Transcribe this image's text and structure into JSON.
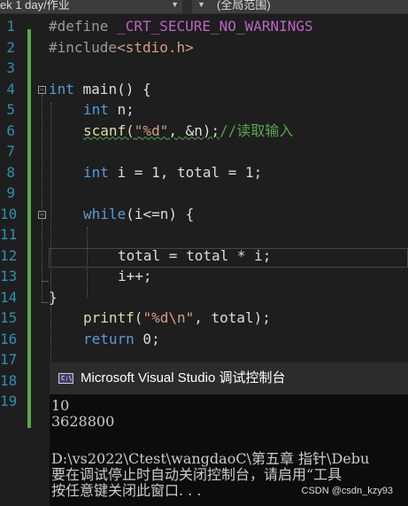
{
  "tabs": {
    "project": "ek 1 day/作业",
    "scope": "(全局范围)"
  },
  "line_numbers": [
    "1",
    "2",
    "3",
    "4",
    "5",
    "6",
    "7",
    "8",
    "9",
    "10",
    "11",
    "12",
    "13",
    "14",
    "15",
    "16",
    "17",
    "18",
    "19"
  ],
  "code": {
    "l1_directive": "#define",
    "l1_macro": "_CRT_SECURE_NO_WARNINGS",
    "l2_directive": "#include",
    "l2_header": "<stdio.h>",
    "l4_type": "int",
    "l4_rest": " main() {",
    "l5_type": "int",
    "l5_rest": " n;",
    "l6_call": "scanf(",
    "l6_format": "\"%d\"",
    "l6_args": ", &n);",
    "l6_comment": "//读取输入",
    "l8_type": "int",
    "l8_rest": " i = 1, total = 1;",
    "l10_keyword": "while",
    "l10_rest": "(i<=n) {",
    "l12_text": "total = total * i;",
    "l13_text": "i++;",
    "l14_text": "}",
    "l15_call": "printf(",
    "l15_format": "\"%d\\n\"",
    "l15_args": ", total);",
    "l16_keyword": "return",
    "l16_rest": " 0;"
  },
  "console": {
    "title": "Microsoft Visual Studio 调试控制台",
    "icon_text": "C:\\",
    "lines": [
      "10",
      "3628800",
      "",
      "D:\\vs2022\\Ctest\\wangdaoC\\第五章 指针\\Debu",
      "要在调试停止时自动关闭控制台，请启用“工具",
      "按任意键关闭此窗口. . ."
    ]
  },
  "watermark": "CSDN @csdn_kzy93",
  "colors": {
    "keyword": "#569cd6",
    "string": "#d69d85",
    "comment": "#57a64a",
    "line_number": "#2b91af",
    "macro": "#bd63c5"
  }
}
